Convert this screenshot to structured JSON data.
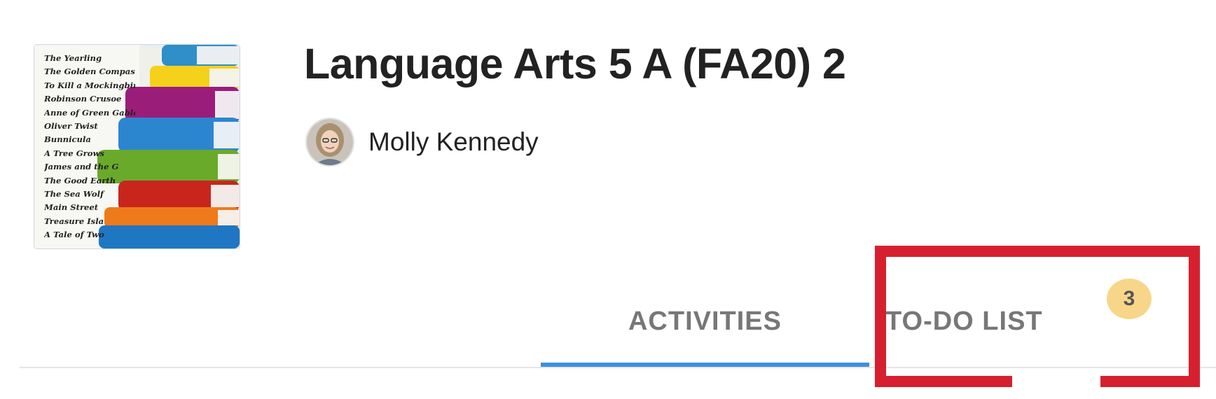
{
  "course": {
    "title": "Language Arts 5 A (FA20) 2",
    "image_book_titles": [
      "The Yearling",
      "The Golden Compass",
      "To Kill a Mockingbird",
      "Robinson Crusoe",
      "Anne of Green Gables",
      "Oliver Twist",
      "Bunnicula",
      "A Tree Grows",
      "James and the G",
      "The Good Earth",
      "The Sea Wolf",
      "Main Street",
      "Treasure Isla",
      "A Tale of Two"
    ]
  },
  "teacher": {
    "name": "Molly Kennedy"
  },
  "tabs": [
    {
      "label": "ACTIVITIES",
      "active": true
    },
    {
      "label": "TO-DO LIST",
      "badge": "3"
    }
  ],
  "colors": {
    "active_tab_underline": "#3d8ee0",
    "badge_bg": "#f7d68a",
    "highlight": "#d7202f"
  }
}
